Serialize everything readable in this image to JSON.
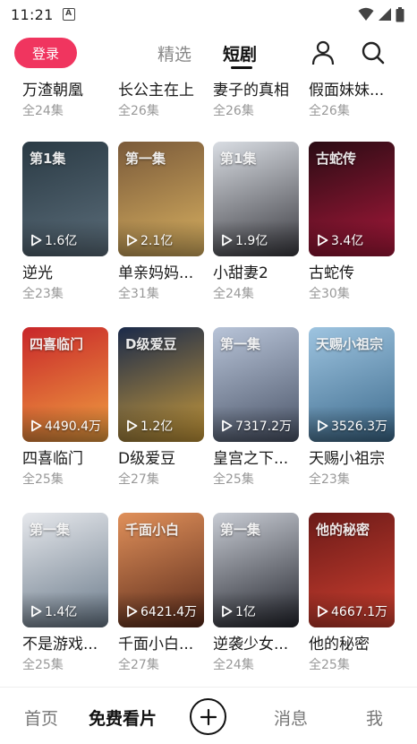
{
  "status_bar": {
    "time": "11:21",
    "notification_glyph": "A"
  },
  "top_nav": {
    "login_label": "登录",
    "tabs": [
      {
        "label": "精选",
        "active": false
      },
      {
        "label": "短剧",
        "active": true
      }
    ]
  },
  "top_row": [
    {
      "title": "万渣朝凰",
      "episodes": "全24集"
    },
    {
      "title": "长公主在上",
      "episodes": "全26集"
    },
    {
      "title": "妻子的真相",
      "episodes": "全26集"
    },
    {
      "title": "假面妹妹...",
      "episodes": "全26集"
    }
  ],
  "dramas": [
    {
      "title": "逆光",
      "episodes": "全23集",
      "plays": "1.6亿",
      "poster_text": "第1集",
      "colors": [
        "#2a3a44",
        "#5b6d7a"
      ]
    },
    {
      "title": "单亲妈妈...",
      "episodes": "全31集",
      "plays": "2.1亿",
      "poster_text": "第一集",
      "colors": [
        "#7a5a3a",
        "#d8b060"
      ]
    },
    {
      "title": "小甜妻2",
      "episodes": "全24集",
      "plays": "1.9亿",
      "poster_text": "第1集",
      "colors": [
        "#d9dde3",
        "#3a3a40"
      ]
    },
    {
      "title": "古蛇传",
      "episodes": "全30集",
      "plays": "3.4亿",
      "poster_text": "古蛇传",
      "colors": [
        "#2a0c14",
        "#a8183a"
      ]
    },
    {
      "title": "四喜临门",
      "episodes": "全25集",
      "plays": "4490.4万",
      "poster_text": "四喜临门",
      "colors": [
        "#c8262a",
        "#f0a040"
      ]
    },
    {
      "title": "D级爱豆",
      "episodes": "全27集",
      "plays": "1.2亿",
      "poster_text": "D级爱豆",
      "colors": [
        "#1a2a4a",
        "#c89a3a"
      ]
    },
    {
      "title": "皇宫之下...",
      "episodes": "全25集",
      "plays": "7317.2万",
      "poster_text": "第一集",
      "colors": [
        "#b8c4d8",
        "#4a5468"
      ]
    },
    {
      "title": "天赐小祖宗",
      "episodes": "全23集",
      "plays": "3526.3万",
      "poster_text": "天赐小祖宗",
      "colors": [
        "#9ec4e0",
        "#3c6a8c"
      ]
    },
    {
      "title": "不是游戏...",
      "episodes": "全25集",
      "plays": "1.4亿",
      "poster_text": "第一集",
      "colors": [
        "#e6e8ec",
        "#6a7a8a"
      ]
    },
    {
      "title": "千面小白...",
      "episodes": "全27集",
      "plays": "6421.4万",
      "poster_text": "千面小白",
      "colors": [
        "#e0905a",
        "#5a2a1a"
      ]
    },
    {
      "title": "逆袭少女...",
      "episodes": "全24集",
      "plays": "1亿",
      "poster_text": "第一集",
      "colors": [
        "#c8ccd4",
        "#24262e"
      ]
    },
    {
      "title": "他的秘密",
      "episodes": "全25集",
      "plays": "4667.1万",
      "poster_text": "他的秘密",
      "colors": [
        "#6a1a18",
        "#d04030"
      ]
    }
  ],
  "bottom_nav": {
    "home": "首页",
    "free": "免费看片",
    "add_icon": "plus-circle-icon",
    "messages": "消息",
    "me": "我"
  },
  "colors": {
    "accent": "#f0355f",
    "muted": "#999999"
  }
}
